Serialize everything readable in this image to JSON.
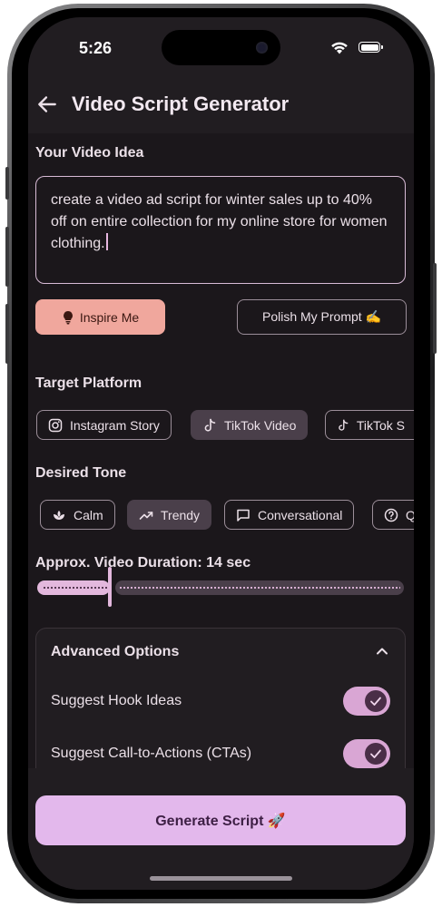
{
  "status_bar": {
    "time": "5:26"
  },
  "app_bar": {
    "title": "Video Script Generator"
  },
  "idea": {
    "label": "Your Video Idea",
    "text": "create a video ad script for winter sales up to 40% off on entire collection for my online store for women clothing."
  },
  "actions": {
    "inspire_label": "Inspire Me",
    "polish_label": "Polish My Prompt ✍️"
  },
  "platform": {
    "label": "Target Platform",
    "chips": [
      {
        "label": "Instagram Story",
        "icon": "instagram-icon",
        "selected": false
      },
      {
        "label": "TikTok Video",
        "icon": "tiktok-icon",
        "selected": true
      },
      {
        "label": "TikTok S",
        "icon": "tiktok-icon",
        "selected": false
      }
    ]
  },
  "tone": {
    "label": "Desired Tone",
    "chips": [
      {
        "label": "Calm",
        "icon": "lotus-icon",
        "selected": false
      },
      {
        "label": "Trendy",
        "icon": "trending-up-icon",
        "selected": true
      },
      {
        "label": "Conversational",
        "icon": "chat-bubble-icon",
        "selected": false
      },
      {
        "label": "Q",
        "icon": "help-circle-icon",
        "selected": false
      }
    ]
  },
  "duration": {
    "label": "Approx. Video Duration: 14 sec",
    "value_fraction": 0.2
  },
  "advanced": {
    "title": "Advanced Options",
    "options": [
      {
        "label": "Suggest Hook Ideas",
        "enabled": true
      },
      {
        "label": "Suggest Call-to-Actions (CTAs)",
        "enabled": true
      }
    ]
  },
  "generate": {
    "label": "Generate Script 🚀"
  },
  "colors": {
    "background": "#1b171b",
    "accent": "#e3b8ec",
    "inspire": "#f0a79d",
    "chip_selected": "#4a3f4a"
  }
}
